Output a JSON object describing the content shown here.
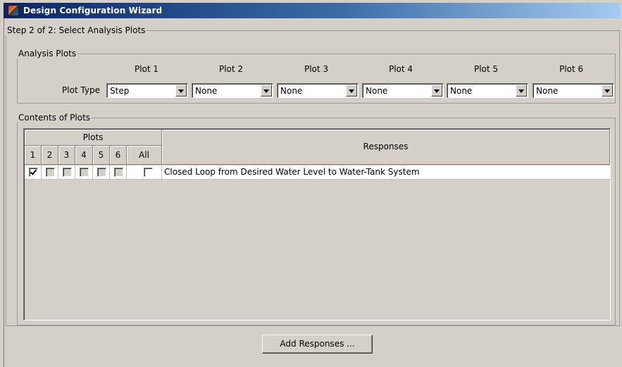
{
  "window": {
    "title": "Design Configuration Wizard"
  },
  "step": {
    "legend": "Step 2 of 2: Select Analysis Plots"
  },
  "analysis_plots": {
    "legend": "Analysis Plots",
    "plot_type_label": "Plot Type",
    "plots": [
      {
        "header": "Plot 1",
        "value": "Step"
      },
      {
        "header": "Plot 2",
        "value": "None"
      },
      {
        "header": "Plot 3",
        "value": "None"
      },
      {
        "header": "Plot 4",
        "value": "None"
      },
      {
        "header": "Plot 5",
        "value": "None"
      },
      {
        "header": "Plot 6",
        "value": "None"
      }
    ]
  },
  "contents": {
    "legend": "Contents of Plots",
    "plots_header": "Plots",
    "columns": [
      "1",
      "2",
      "3",
      "4",
      "5",
      "6",
      "All"
    ],
    "responses_header": "Responses",
    "rows": [
      {
        "response": "Closed Loop from Desired  Water Level to Water-Tank System",
        "checks": [
          true,
          false,
          false,
          false,
          false,
          false,
          false
        ],
        "enabled": [
          true,
          false,
          false,
          false,
          false,
          false,
          true
        ]
      }
    ]
  },
  "add_button": {
    "label": "Add Responses ..."
  }
}
